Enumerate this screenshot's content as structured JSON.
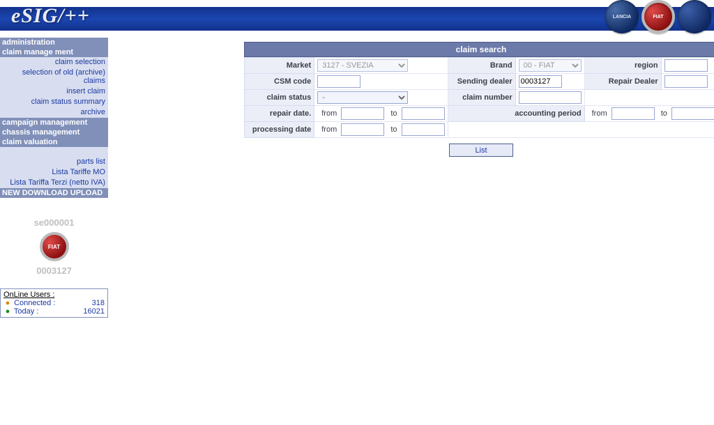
{
  "app": {
    "name": "eSIG/++"
  },
  "brands": {
    "lancia_label": "LANCIA",
    "fiat_label": "FIAT"
  },
  "sidebar": {
    "groups": {
      "admin": "administration",
      "claim_mgmt": "claim manage ment",
      "campaign": "campaign management",
      "chassis": "chassis management",
      "valuation": "claim valuation",
      "download": "NEW DOWNLOAD UPLOAD"
    },
    "claim_items": [
      "claim selection",
      "selection of old (archive) claims",
      "insert claim",
      "claim status summary",
      "archive"
    ],
    "valuation_items": [
      "parts list",
      "Lista Tariffe MO",
      "Lista Tariffa Terzi (netto IVA)"
    ]
  },
  "user": {
    "code": "se000001",
    "dealer": "0003127"
  },
  "online": {
    "title": "OnLine Users :",
    "connected_label": "Connected :",
    "connected_value": "318",
    "today_label": "Today :",
    "today_value": "16021"
  },
  "search": {
    "title": "claim search",
    "labels": {
      "market": "Market",
      "brand": "Brand",
      "region": "region",
      "csm_code": "CSM code",
      "sending_dealer": "Sending dealer",
      "repair_dealer": "Repair Dealer",
      "claim_status": "claim status",
      "claim_number": "claim number",
      "repair_date": "repair date.",
      "processing_date": "processing date",
      "accounting_period": "accounting period",
      "from": "from",
      "to": "to"
    },
    "values": {
      "market": "3127 - SVEZIA",
      "brand": "00 - FIAT",
      "region": "",
      "csm_code": "",
      "sending_dealer": "0003127",
      "repair_dealer": "",
      "claim_status": "-",
      "claim_number": "",
      "repair_from": "",
      "repair_to": "",
      "proc_from": "",
      "proc_to": "",
      "acct_from": "",
      "acct_to": ""
    },
    "button_list": "List"
  }
}
